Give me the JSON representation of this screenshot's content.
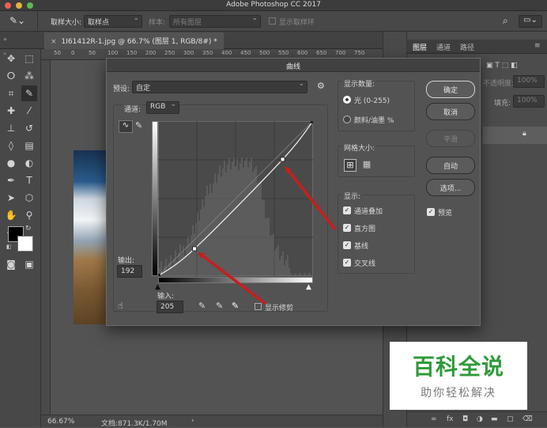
{
  "app": {
    "title": "Adobe Photoshop CC 2017"
  },
  "options_bar": {
    "sample_size_label": "取样大小:",
    "sample_size_value": "取样点",
    "sample_label": "样本:",
    "sample_value": "所有图层",
    "show_ring_label": "显示取样环"
  },
  "document": {
    "tab_label": "1I61412R-1.jpg @ 66.7% (图层 1, RGB/8#) *",
    "ruler_numbers": [
      "50",
      "0",
      "50",
      "100",
      "150",
      "200",
      "250",
      "300",
      "350",
      "400",
      "450",
      "500",
      "550",
      "600",
      "650",
      "700",
      "750"
    ],
    "zoom": "66.67%",
    "doc_size": "文档:871.3K/1.70M"
  },
  "layers_panel": {
    "tabs": [
      "图层",
      "通道",
      "路径"
    ],
    "opacity_label": "不透明度:",
    "opacity_value": "100%",
    "fill_label": "填充:",
    "fill_value": "100%",
    "bottom_icons": [
      "link-icon",
      "fx-icon",
      "mask-icon",
      "adjustment-icon",
      "folder-icon",
      "new-layer-icon",
      "trash-icon"
    ]
  },
  "curves": {
    "title": "曲线",
    "preset_label": "预设:",
    "preset_value": "自定",
    "channel_label": "通道:",
    "channel_value": "RGB",
    "output_label": "输出:",
    "output_value": "192",
    "input_label": "输入:",
    "input_value": "205",
    "show_clipping_label": "显示修剪",
    "show_amount_title": "显示数量:",
    "light_label": "光 (0-255)",
    "pigment_label": "颜料/油墨 %",
    "grid_size_title": "网格大小:",
    "show_title": "显示:",
    "checkboxes": [
      "通道叠加",
      "直方图",
      "基线",
      "交叉线"
    ],
    "buttons": {
      "ok": "确定",
      "cancel": "取消",
      "smooth": "平滑",
      "auto": "自动",
      "options": "选项..."
    },
    "preview_label": "预览",
    "curve_points": [
      [
        0,
        0
      ],
      [
        60,
        45
      ],
      [
        205,
        192
      ],
      [
        255,
        255
      ]
    ]
  },
  "watermark": {
    "title": "百科全说",
    "subtitle": "助你轻松解决"
  },
  "colors": {
    "accent_red": "#c81e1e",
    "watermark_green": "#2f9a3a"
  }
}
